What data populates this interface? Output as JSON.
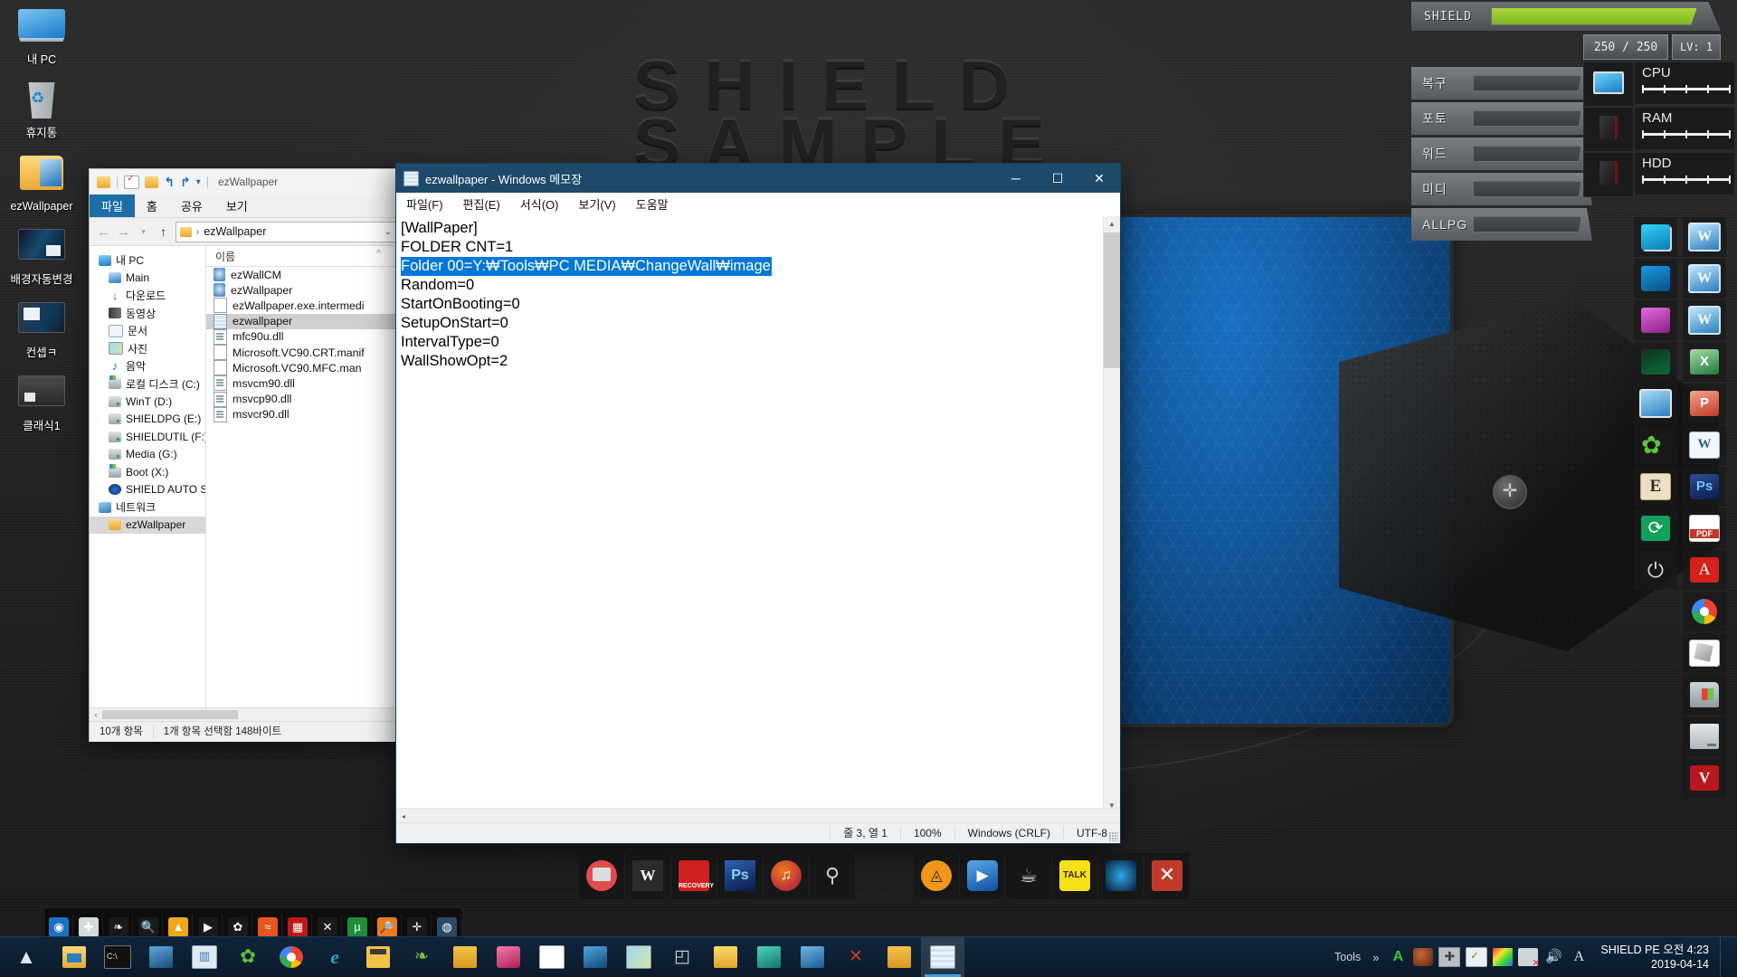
{
  "wallpaper": {
    "word1": "SHIELD",
    "word2": "SAMPLE"
  },
  "desktop_icons": [
    {
      "label": "내 PC",
      "icon": "my-computer-icon"
    },
    {
      "label": "휴지통",
      "icon": "recycle-bin-icon"
    },
    {
      "label": "ezWallpaper",
      "icon": "folder-ezwallpaper-icon"
    },
    {
      "label": "배경자동변경",
      "icon": "wallpaper-autochange-icon"
    },
    {
      "label": "컨셉ㅋ",
      "icon": "concept-image-icon"
    },
    {
      "label": "클래식1",
      "icon": "classic1-image-icon"
    }
  ],
  "explorer": {
    "qat_title": "ezWallpaper",
    "tabs": [
      "파일",
      "홈",
      "공유",
      "보기"
    ],
    "address": "ezWallpaper",
    "nav_items": [
      {
        "label": "내 PC",
        "level": 0,
        "icon": "computer-icon",
        "selected": false
      },
      {
        "label": "Main",
        "level": 1,
        "icon": "desktop-icon",
        "selected": false
      },
      {
        "label": "다운로드",
        "level": 1,
        "icon": "downloads-icon",
        "selected": false
      },
      {
        "label": "동영상",
        "level": 1,
        "icon": "videos-icon",
        "selected": false
      },
      {
        "label": "문서",
        "level": 1,
        "icon": "documents-icon",
        "selected": false
      },
      {
        "label": "사진",
        "level": 1,
        "icon": "pictures-icon",
        "selected": false
      },
      {
        "label": "음악",
        "level": 1,
        "icon": "music-icon",
        "selected": false
      },
      {
        "label": "로컬 디스크 (C:)",
        "level": 1,
        "icon": "windows-drive-icon",
        "selected": false
      },
      {
        "label": "WinT (D:)",
        "level": 1,
        "icon": "drive-icon",
        "selected": false
      },
      {
        "label": "SHIELDPG (E:)",
        "level": 1,
        "icon": "drive-icon",
        "selected": false
      },
      {
        "label": "SHIELDUTIL (F:)",
        "level": 1,
        "icon": "drive-icon",
        "selected": false
      },
      {
        "label": "Media (G:)",
        "level": 1,
        "icon": "drive-icon",
        "selected": false
      },
      {
        "label": "Boot (X:)",
        "level": 1,
        "icon": "windows-drive-icon",
        "selected": false
      },
      {
        "label": "SHIELD AUTO SSD",
        "level": 1,
        "icon": "ssd-icon",
        "selected": false
      },
      {
        "label": "네트워크",
        "level": 0,
        "icon": "network-icon",
        "selected": false
      },
      {
        "label": "ezWallpaper",
        "level": 1,
        "icon": "folder-icon",
        "selected": true
      }
    ],
    "column_header": "이름",
    "files": [
      {
        "name": "ezWallCM",
        "icon": "executable-icon",
        "selected": false
      },
      {
        "name": "ezWallpaper",
        "icon": "executable-icon",
        "selected": false
      },
      {
        "name": "ezWallpaper.exe.intermedi",
        "icon": "text-file-icon",
        "selected": false
      },
      {
        "name": "ezwallpaper",
        "icon": "notepad-file-icon",
        "selected": true
      },
      {
        "name": "mfc90u.dll",
        "icon": "dll-icon",
        "selected": false
      },
      {
        "name": "Microsoft.VC90.CRT.manif",
        "icon": "text-file-icon",
        "selected": false
      },
      {
        "name": "Microsoft.VC90.MFC.man",
        "icon": "text-file-icon",
        "selected": false
      },
      {
        "name": "msvcm90.dll",
        "icon": "dll-icon",
        "selected": false
      },
      {
        "name": "msvcp90.dll",
        "icon": "dll-icon",
        "selected": false
      },
      {
        "name": "msvcr90.dll",
        "icon": "dll-icon",
        "selected": false
      }
    ],
    "status": {
      "count": "10개 항목",
      "selection": "1개 항목 선택함 148바이트"
    }
  },
  "notepad": {
    "title": "ezwallpaper - Windows 메모장",
    "menu": [
      "파일(F)",
      "편집(E)",
      "서식(O)",
      "보기(V)",
      "도움말"
    ],
    "controls": {
      "minimize": "─",
      "maximize": "☐",
      "close": "✕"
    },
    "lines": [
      {
        "text": "[WallPaper]",
        "highlighted": false
      },
      {
        "text": "FOLDER CNT=1",
        "highlighted": false
      },
      {
        "text": "Folder 00=Y:₩Tools₩PC MEDIA₩ChangeWall₩image",
        "highlighted": true
      },
      {
        "text": "Random=0",
        "highlighted": false
      },
      {
        "text": "StartOnBooting=0",
        "highlighted": false
      },
      {
        "text": "SetupOnStart=0",
        "highlighted": false
      },
      {
        "text": "IntervalType=0",
        "highlighted": false
      },
      {
        "text": "WallShowOpt=2",
        "highlighted": false
      }
    ],
    "status": {
      "position": "줄 3, 열 1",
      "zoom": "100%",
      "line_ending": "Windows (CRLF)",
      "encoding": "UTF-8"
    }
  },
  "hud": {
    "main": {
      "label": "SHIELD",
      "hp": "250 / 250",
      "level": "LV: 1",
      "fill_percent": 100,
      "color": "#93c934"
    },
    "rows": [
      {
        "label": "복구",
        "fill_percent": 0
      },
      {
        "label": "포토",
        "fill_percent": 0
      },
      {
        "label": "워드",
        "fill_percent": 0
      },
      {
        "label": "미디",
        "fill_percent": 0
      },
      {
        "label": "ALLPG",
        "fill_percent": 0
      }
    ],
    "meters": [
      {
        "label": "CPU",
        "icon": "monitor-icon",
        "ticks": 4
      },
      {
        "label": "RAM",
        "icon": "pc-case-icon",
        "ticks": 4
      },
      {
        "label": "HDD",
        "icon": "pc-case-icon",
        "ticks": 4
      }
    ]
  },
  "right_dock_a": [
    {
      "icon": "monitor-cyan-icon"
    },
    {
      "icon": "monitor-blue-icon"
    },
    {
      "icon": "monitor-pink-icon"
    },
    {
      "icon": "monitor-matrix-icon"
    },
    {
      "icon": "desktop-pc-icon"
    },
    {
      "icon": "clover-icon"
    },
    {
      "icon": "scrabble-e-icon"
    },
    {
      "icon": "refresh-green-icon"
    },
    {
      "icon": "power-icon"
    }
  ],
  "right_dock_b": [
    {
      "icon": "word-viewer-icon"
    },
    {
      "icon": "word-viewer-icon"
    },
    {
      "icon": "word-viewer-icon"
    },
    {
      "icon": "excel-icon"
    },
    {
      "icon": "powerpoint-icon"
    },
    {
      "icon": "word-doc-icon"
    },
    {
      "icon": "photoshop-icon"
    },
    {
      "icon": "pdf-icon"
    },
    {
      "icon": "acrobat-icon"
    },
    {
      "icon": "chrome-icon"
    },
    {
      "icon": "floppy-tool-icon"
    },
    {
      "icon": "windows-folder-icon"
    },
    {
      "icon": "hdd-icon"
    },
    {
      "icon": "v-red-icon"
    }
  ],
  "center_dock_left": [
    {
      "icon": "red-monitor-icon"
    },
    {
      "icon": "word-icon"
    },
    {
      "icon": "recovery-icon"
    },
    {
      "icon": "photoshop-icon"
    },
    {
      "icon": "music-icon"
    },
    {
      "icon": "camera-icon"
    }
  ],
  "center_dock_right": [
    {
      "icon": "orange-triangle-icon"
    },
    {
      "icon": "play-blue-icon"
    },
    {
      "icon": "coffee-cup-icon"
    },
    {
      "icon": "kakaotalk-icon"
    },
    {
      "icon": "blue-globe-icon"
    },
    {
      "icon": "red-x-icon"
    }
  ],
  "mini_dock": [
    {
      "icon": "blue-app-icon",
      "glyph": "◉",
      "bg": "#1b72c4"
    },
    {
      "icon": "plus-icon",
      "glyph": "✚",
      "bg": "#d6dadd"
    },
    {
      "icon": "leaf-icon",
      "glyph": "❧",
      "bg": "#1a1a1a"
    },
    {
      "icon": "search-orange-icon",
      "glyph": "🔍",
      "bg": "#1a1a1a"
    },
    {
      "icon": "amber-circle-icon",
      "glyph": "▲",
      "bg": "#f0a81a"
    },
    {
      "icon": "play-live-icon",
      "glyph": "▶",
      "bg": "#1a1a1a"
    },
    {
      "icon": "clover-icon",
      "glyph": "✿",
      "bg": "#1a1a1a"
    },
    {
      "icon": "orange-hex-icon",
      "glyph": "≈",
      "bg": "#e8551a"
    },
    {
      "icon": "red-grid-icon",
      "glyph": "▦",
      "bg": "#c01818"
    },
    {
      "icon": "x-tool-icon",
      "glyph": "✕",
      "bg": "#1a1a1a"
    },
    {
      "icon": "utorrent-icon",
      "glyph": "µ",
      "bg": "#1d8d3a"
    },
    {
      "icon": "magnify-orange-icon",
      "glyph": "🔎",
      "bg": "#f07a1a"
    },
    {
      "icon": "red-puzzle-icon",
      "glyph": "✛",
      "bg": "#1a1a1a"
    },
    {
      "icon": "disk-icon",
      "glyph": "◍",
      "bg": "#2a4a66"
    }
  ],
  "taskbar": {
    "start_glyph": "▲",
    "items": [
      {
        "icon": "file-explorer-icon",
        "active": false
      },
      {
        "icon": "command-prompt-icon",
        "active": false
      },
      {
        "icon": "remote-desktop-icon",
        "active": false
      },
      {
        "icon": "perf-monitor-icon",
        "active": false
      },
      {
        "icon": "clover-icon",
        "active": false
      },
      {
        "icon": "chrome-icon",
        "active": false
      },
      {
        "icon": "internet-explorer-icon",
        "active": false
      },
      {
        "icon": "calculator-icon",
        "active": false
      },
      {
        "icon": "leaf-icon",
        "active": false
      },
      {
        "icon": "sticky-note-icon",
        "active": false
      },
      {
        "icon": "pink-app-icon",
        "active": false
      },
      {
        "icon": "document-icon",
        "active": false
      },
      {
        "icon": "blue-app-icon",
        "active": false
      },
      {
        "icon": "photo-viewer-icon",
        "active": false
      },
      {
        "icon": "3d-box-icon",
        "active": false
      },
      {
        "icon": "yellow-app-icon",
        "active": false
      },
      {
        "icon": "teal-app-icon",
        "active": false
      },
      {
        "icon": "blue-tool-icon",
        "active": false
      },
      {
        "icon": "red-x-icon",
        "active": false
      },
      {
        "icon": "sticky-note-icon",
        "active": false
      },
      {
        "icon": "notepad-icon",
        "active": true
      }
    ],
    "tray": {
      "tools_label": "Tools",
      "overflow_glyph": "»",
      "icons": [
        {
          "icon": "antivirus-icon"
        },
        {
          "icon": "planet-icon"
        },
        {
          "icon": "plus-tool-icon"
        },
        {
          "icon": "usb-safely-remove-icon"
        },
        {
          "icon": "color-picker-icon"
        },
        {
          "icon": "network-disconnected-icon"
        },
        {
          "icon": "volume-icon"
        },
        {
          "icon": "ime-icon"
        }
      ]
    },
    "clock": {
      "line1": "SHIELD PE 오전 4:23",
      "line2": "2019-04-14"
    }
  }
}
